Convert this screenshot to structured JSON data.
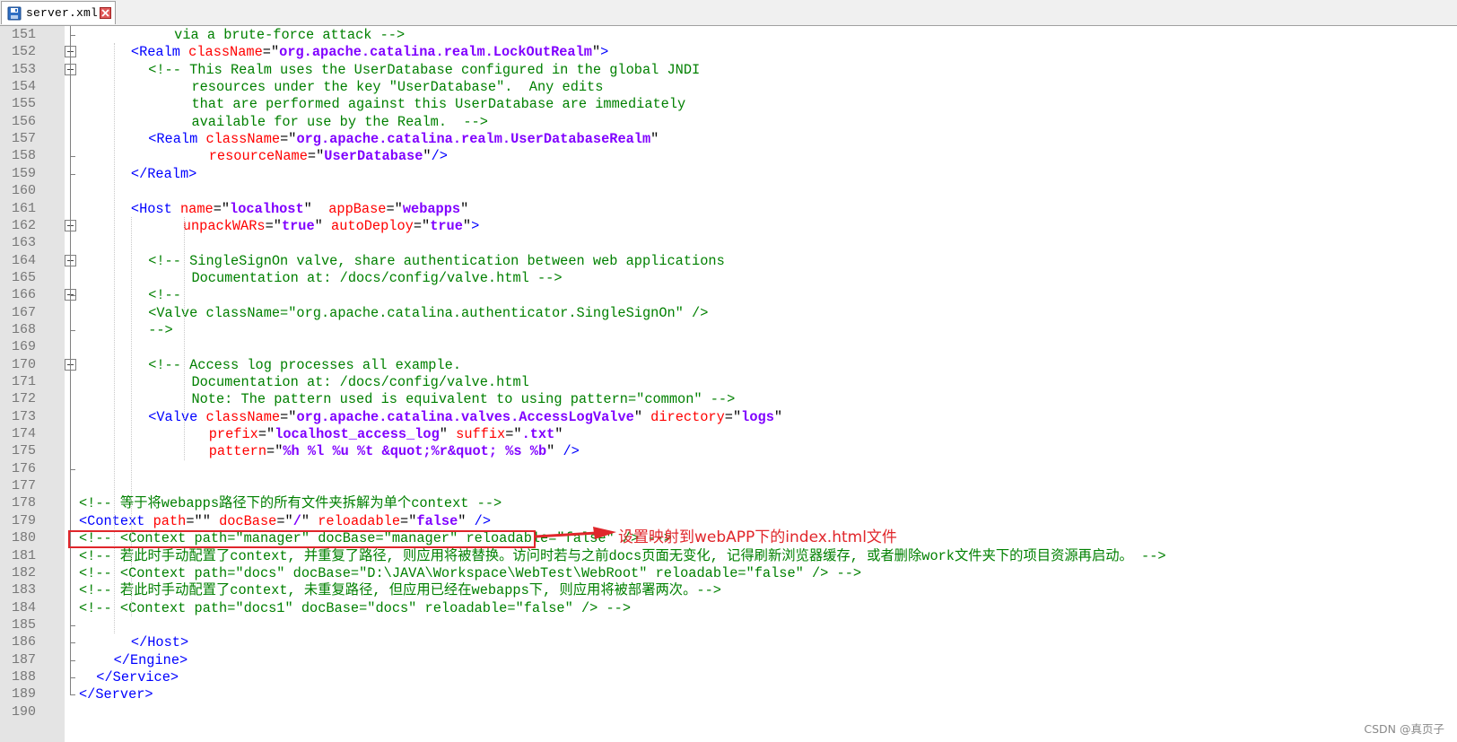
{
  "tab": {
    "filename": "server.xml"
  },
  "watermark": "CSDN @真页子",
  "annotation": "设置映射到webAPP下的index.html文件",
  "lines": [
    {
      "num": "151",
      "indent": 11,
      "segs": [
        {
          "t": "via a brute-force attack -->",
          "c": "comment"
        }
      ]
    },
    {
      "num": "152",
      "indent": 6,
      "segs": [
        {
          "t": "<Realm ",
          "c": "tag"
        },
        {
          "t": "className",
          "c": "attr"
        },
        {
          "t": "=\"",
          "c": "plain"
        },
        {
          "t": "org.apache.catalina.realm.LockOutRealm",
          "c": "val"
        },
        {
          "t": "\"",
          "c": "plain"
        },
        {
          "t": ">",
          "c": "tag"
        }
      ]
    },
    {
      "num": "153",
      "indent": 8,
      "segs": [
        {
          "t": "<!-- This Realm uses the UserDatabase configured in the global JNDI",
          "c": "comment"
        }
      ]
    },
    {
      "num": "154",
      "indent": 13,
      "segs": [
        {
          "t": "resources under the key \"UserDatabase\".  Any edits",
          "c": "comment"
        }
      ]
    },
    {
      "num": "155",
      "indent": 13,
      "segs": [
        {
          "t": "that are performed against this UserDatabase are immediately",
          "c": "comment"
        }
      ]
    },
    {
      "num": "156",
      "indent": 13,
      "segs": [
        {
          "t": "available for use by the Realm.  -->",
          "c": "comment"
        }
      ]
    },
    {
      "num": "157",
      "indent": 8,
      "segs": [
        {
          "t": "<Realm ",
          "c": "tag"
        },
        {
          "t": "className",
          "c": "attr"
        },
        {
          "t": "=\"",
          "c": "plain"
        },
        {
          "t": "org.apache.catalina.realm.UserDatabaseRealm",
          "c": "val"
        },
        {
          "t": "\"",
          "c": "plain"
        }
      ]
    },
    {
      "num": "158",
      "indent": 15,
      "segs": [
        {
          "t": "resourceName",
          "c": "attr"
        },
        {
          "t": "=\"",
          "c": "plain"
        },
        {
          "t": "UserDatabase",
          "c": "val"
        },
        {
          "t": "\"",
          "c": "plain"
        },
        {
          "t": "/>",
          "c": "tag"
        }
      ]
    },
    {
      "num": "159",
      "indent": 6,
      "segs": [
        {
          "t": "</Realm>",
          "c": "tag"
        }
      ]
    },
    {
      "num": "160",
      "indent": 0,
      "segs": []
    },
    {
      "num": "161",
      "indent": 6,
      "segs": [
        {
          "t": "<Host ",
          "c": "tag"
        },
        {
          "t": "name",
          "c": "attr"
        },
        {
          "t": "=\"",
          "c": "plain"
        },
        {
          "t": "localhost",
          "c": "val"
        },
        {
          "t": "\"  ",
          "c": "plain"
        },
        {
          "t": "appBase",
          "c": "attr"
        },
        {
          "t": "=\"",
          "c": "plain"
        },
        {
          "t": "webapps",
          "c": "val"
        },
        {
          "t": "\"",
          "c": "plain"
        }
      ]
    },
    {
      "num": "162",
      "indent": 12,
      "segs": [
        {
          "t": "unpackWARs",
          "c": "attr"
        },
        {
          "t": "=\"",
          "c": "plain"
        },
        {
          "t": "true",
          "c": "val"
        },
        {
          "t": "\" ",
          "c": "plain"
        },
        {
          "t": "autoDeploy",
          "c": "attr"
        },
        {
          "t": "=\"",
          "c": "plain"
        },
        {
          "t": "true",
          "c": "val"
        },
        {
          "t": "\"",
          "c": "plain"
        },
        {
          "t": ">",
          "c": "tag"
        }
      ]
    },
    {
      "num": "163",
      "indent": 0,
      "segs": []
    },
    {
      "num": "164",
      "indent": 8,
      "segs": [
        {
          "t": "<!-- SingleSignOn valve, share authentication between web applications",
          "c": "comment"
        }
      ]
    },
    {
      "num": "165",
      "indent": 13,
      "segs": [
        {
          "t": "Documentation at: /docs/config/valve.html -->",
          "c": "comment"
        }
      ]
    },
    {
      "num": "166",
      "indent": 8,
      "segs": [
        {
          "t": "<!--",
          "c": "comment"
        }
      ]
    },
    {
      "num": "167",
      "indent": 8,
      "segs": [
        {
          "t": "<Valve className=\"org.apache.catalina.authenticator.SingleSignOn\" />",
          "c": "comment"
        }
      ]
    },
    {
      "num": "168",
      "indent": 8,
      "segs": [
        {
          "t": "-->",
          "c": "comment"
        }
      ]
    },
    {
      "num": "169",
      "indent": 0,
      "segs": []
    },
    {
      "num": "170",
      "indent": 8,
      "segs": [
        {
          "t": "<!-- Access log processes all example.",
          "c": "comment"
        }
      ]
    },
    {
      "num": "171",
      "indent": 13,
      "segs": [
        {
          "t": "Documentation at: /docs/config/valve.html",
          "c": "comment"
        }
      ]
    },
    {
      "num": "172",
      "indent": 13,
      "segs": [
        {
          "t": "Note: The pattern used is equivalent to using pattern=\"common\" -->",
          "c": "comment"
        }
      ]
    },
    {
      "num": "173",
      "indent": 8,
      "segs": [
        {
          "t": "<Valve ",
          "c": "tag"
        },
        {
          "t": "className",
          "c": "attr"
        },
        {
          "t": "=\"",
          "c": "plain"
        },
        {
          "t": "org.apache.catalina.valves.AccessLogValve",
          "c": "val"
        },
        {
          "t": "\" ",
          "c": "plain"
        },
        {
          "t": "directory",
          "c": "attr"
        },
        {
          "t": "=\"",
          "c": "plain"
        },
        {
          "t": "logs",
          "c": "val"
        },
        {
          "t": "\"",
          "c": "plain"
        }
      ]
    },
    {
      "num": "174",
      "indent": 15,
      "segs": [
        {
          "t": "prefix",
          "c": "attr"
        },
        {
          "t": "=\"",
          "c": "plain"
        },
        {
          "t": "localhost_access_log",
          "c": "val"
        },
        {
          "t": "\" ",
          "c": "plain"
        },
        {
          "t": "suffix",
          "c": "attr"
        },
        {
          "t": "=\"",
          "c": "plain"
        },
        {
          "t": ".txt",
          "c": "val"
        },
        {
          "t": "\"",
          "c": "plain"
        }
      ]
    },
    {
      "num": "175",
      "indent": 15,
      "segs": [
        {
          "t": "pattern",
          "c": "attr"
        },
        {
          "t": "=\"",
          "c": "plain"
        },
        {
          "t": "%h %l %u %t &quot;%r&quot; %s %b",
          "c": "val"
        },
        {
          "t": "\" ",
          "c": "plain"
        },
        {
          "t": "/>",
          "c": "tag"
        }
      ]
    },
    {
      "num": "176",
      "indent": 0,
      "segs": []
    },
    {
      "num": "177",
      "indent": 0,
      "segs": []
    },
    {
      "num": "178",
      "indent": 0,
      "segs": [
        {
          "t": "<!-- 等于将webapps路径下的所有文件夹拆解为单个context -->",
          "c": "comment"
        }
      ]
    },
    {
      "num": "179",
      "indent": 0,
      "segs": [
        {
          "t": "<Context ",
          "c": "tag"
        },
        {
          "t": "path",
          "c": "attr"
        },
        {
          "t": "=\"\" ",
          "c": "plain"
        },
        {
          "t": "docBase",
          "c": "attr"
        },
        {
          "t": "=\"",
          "c": "plain"
        },
        {
          "t": "/",
          "c": "val"
        },
        {
          "t": "\" ",
          "c": "plain"
        },
        {
          "t": "reloadable",
          "c": "attr"
        },
        {
          "t": "=\"",
          "c": "plain"
        },
        {
          "t": "false",
          "c": "val"
        },
        {
          "t": "\" ",
          "c": "plain"
        },
        {
          "t": "/>",
          "c": "tag"
        }
      ]
    },
    {
      "num": "180",
      "indent": 0,
      "segs": [
        {
          "t": "<!-- <Context path=\"manager\" docBase=\"manager\" reloadable=\"false\" /> -->",
          "c": "comment"
        }
      ]
    },
    {
      "num": "181",
      "indent": 0,
      "segs": [
        {
          "t": "<!-- 若此时手动配置了context, 并重复了路径, 则应用将被替换。访问时若与之前docs页面无变化, 记得刷新浏览器缓存, 或者删除work文件夹下的项目资源再启动。 -->",
          "c": "comment"
        }
      ]
    },
    {
      "num": "182",
      "indent": 0,
      "segs": [
        {
          "t": "<!-- <Context path=\"docs\" docBase=\"D:\\JAVA\\Workspace\\WebTest\\WebRoot\" reloadable=\"false\" /> -->",
          "c": "comment"
        }
      ]
    },
    {
      "num": "183",
      "indent": 0,
      "segs": [
        {
          "t": "<!-- 若此时手动配置了context, 未重复路径, 但应用已经在webapps下, 则应用将被部署两次。-->",
          "c": "comment"
        }
      ]
    },
    {
      "num": "184",
      "indent": 0,
      "segs": [
        {
          "t": "<!-- <Context path=\"docs1\" docBase=\"docs\" reloadable=\"false\" /> -->",
          "c": "comment"
        }
      ]
    },
    {
      "num": "185",
      "indent": 0,
      "segs": []
    },
    {
      "num": "186",
      "indent": 6,
      "segs": [
        {
          "t": "</Host>",
          "c": "tag"
        }
      ]
    },
    {
      "num": "187",
      "indent": 4,
      "segs": [
        {
          "t": "</Engine>",
          "c": "tag"
        }
      ]
    },
    {
      "num": "188",
      "indent": 2,
      "segs": [
        {
          "t": "</Service>",
          "c": "tag"
        }
      ]
    },
    {
      "num": "189",
      "indent": 0,
      "segs": [
        {
          "t": "</Server>",
          "c": "tag"
        }
      ]
    },
    {
      "num": "190",
      "indent": 0,
      "segs": []
    }
  ],
  "colors": {
    "comment": "#008000",
    "tag": "#0000ff",
    "attr": "#ff0000",
    "value": "#8000ff",
    "annotation": "#e0262b"
  }
}
